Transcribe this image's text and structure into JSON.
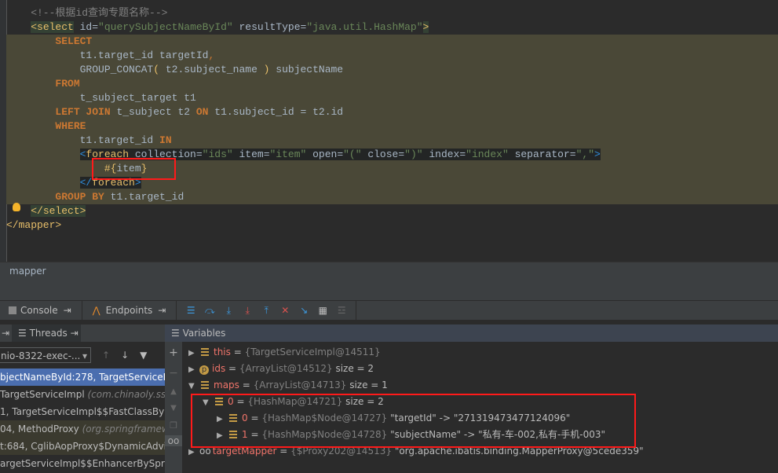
{
  "editor": {
    "lines": [
      [
        [
          "    <!--根据id查询专题名称-->",
          "c"
        ]
      ],
      [
        [
          "    ",
          ""
        ],
        [
          "<select",
          "tg"
        ],
        [
          " id=",
          ""
        ],
        [
          "\"querySubjectNameById\"",
          "s"
        ],
        [
          " resultType=",
          ""
        ],
        [
          "\"java.util.HashMap\"",
          "s"
        ],
        [
          ">",
          "tg"
        ]
      ],
      [
        [
          "        ",
          ""
        ],
        [
          "SELECT",
          "k"
        ]
      ],
      [
        [
          "            t1.target_id targetId",
          ""
        ],
        [
          ",",
          "p"
        ]
      ],
      [
        [
          "            GROUP_CONCAT",
          ""
        ],
        [
          "(",
          "y"
        ],
        [
          " t2.subject_name ",
          ""
        ],
        [
          ")",
          "y"
        ],
        [
          " subjectName",
          ""
        ]
      ],
      [
        [
          "        ",
          ""
        ],
        [
          "FROM",
          "k"
        ]
      ],
      [
        [
          "            t_subject_target t1",
          ""
        ]
      ],
      [
        [
          "        ",
          ""
        ],
        [
          "LEFT JOIN",
          "k"
        ],
        [
          " t_subject t2 ",
          ""
        ],
        [
          "ON",
          "k"
        ],
        [
          " t1.subject_id = t2.id",
          ""
        ]
      ],
      [
        [
          "        ",
          ""
        ],
        [
          "WHERE",
          "k"
        ]
      ],
      [
        [
          "            t1.target_id ",
          ""
        ],
        [
          "IN",
          "k"
        ]
      ],
      [
        [
          "            ",
          ""
        ],
        [
          "<",
          "bl"
        ],
        [
          "foreach",
          "t ft"
        ],
        [
          " collection=",
          "ft"
        ],
        [
          "\"ids\"",
          "s ft"
        ],
        [
          " item=",
          "ft"
        ],
        [
          "\"item\"",
          "s ft"
        ],
        [
          " open=",
          "ft"
        ],
        [
          "\"(\"",
          "s ft"
        ],
        [
          " close=",
          "ft"
        ],
        [
          "\")\"",
          "s ft"
        ],
        [
          " index=",
          "ft"
        ],
        [
          "\"index\"",
          "s ft"
        ],
        [
          " separator=",
          "ft"
        ],
        [
          "\",\"",
          "s ft"
        ],
        [
          ">",
          "bl"
        ]
      ],
      [
        [
          "                ",
          ""
        ],
        [
          "#{",
          "y"
        ],
        [
          "item",
          ""
        ],
        [
          "}",
          "y"
        ]
      ],
      [
        [
          "            ",
          ""
        ],
        [
          "</",
          "bl"
        ],
        [
          "foreach",
          "t ft"
        ],
        [
          ">",
          "bl"
        ]
      ],
      [
        [
          "        ",
          ""
        ],
        [
          "GROUP BY",
          "k"
        ],
        [
          " t1.target_id",
          ""
        ]
      ],
      [
        [
          "    ",
          ""
        ],
        [
          "</select>",
          "tg"
        ]
      ],
      [
        [
          "</mapper>",
          "t"
        ]
      ]
    ]
  },
  "breadcrumb": "mapper",
  "toolbar": {
    "console": "Console",
    "endpoints": "Endpoints"
  },
  "tabs": {
    "threads": "Threads",
    "variables": "Variables"
  },
  "thread_select": "nio-8322-exec-...",
  "frames": [
    {
      "text": "bjectNameById:278, TargetServiceIm",
      "pkg": ""
    },
    {
      "text": "TargetServiceImpl ",
      "pkg": "(com.chinaoly.ssb"
    },
    {
      "text": "1, TargetServiceImpl$$FastClassBySp",
      "pkg": ""
    },
    {
      "text": "04, MethodProxy ",
      "pkg": "(org.springframew"
    },
    {
      "text": "t:684, CglibAopProxy$DynamicAdvise",
      "pkg": ""
    },
    {
      "text": "argetServiceImpl$$EnhancerBySpring",
      "pkg": ""
    }
  ],
  "variables": [
    {
      "name": "this",
      "type": "{TargetServiceImpl@14511}",
      "extra": "",
      "icon": "field-icon",
      "indent": 0,
      "open": false
    },
    {
      "name": "ids",
      "type": "{ArrayList@14512}",
      "extra": "size = 2",
      "icon": "parameter-icon",
      "indent": 0,
      "open": false
    },
    {
      "name": "maps",
      "type": "{ArrayList@14713}",
      "extra": "size = 1",
      "icon": "field-icon",
      "indent": 0,
      "open": true
    },
    {
      "name": "0",
      "type": "{HashMap@14721}",
      "extra": "size = 2",
      "icon": "field-icon",
      "indent": 1,
      "open": true
    },
    {
      "name": "0",
      "type": "{HashMap$Node@14727}",
      "extra": "\"targetId\" -> \"271319473477124096\"",
      "icon": "field-icon",
      "indent": 2,
      "open": false
    },
    {
      "name": "1",
      "type": "{HashMap$Node@14728}",
      "extra": "\"subjectName\" -> \"私有-车-002,私有-手机-003\"",
      "icon": "field-icon",
      "indent": 2,
      "open": false
    },
    {
      "name": "targetMapper",
      "type": "{$Proxy202@14513}",
      "extra": "\"org.apache.ibatis.binding.MapperProxy@5cede359\"",
      "icon": "watch-icon",
      "indent": 0,
      "open": false
    }
  ]
}
